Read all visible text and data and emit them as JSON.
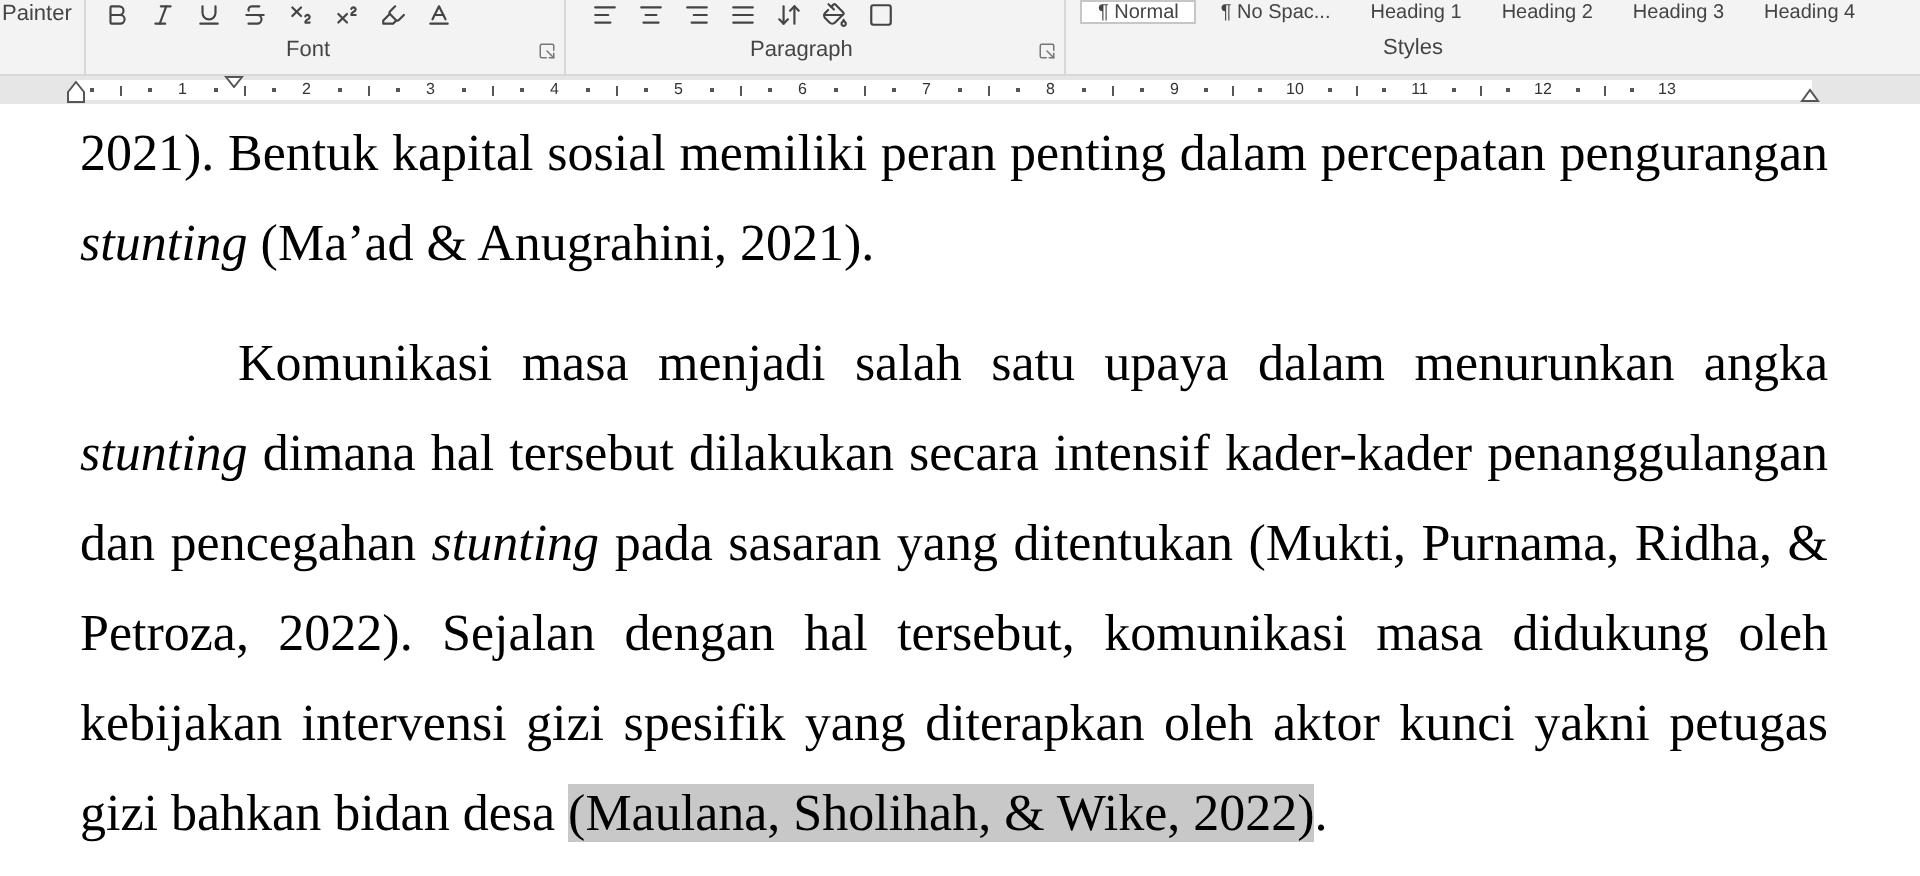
{
  "ribbon": {
    "clipboard_label": "Painter",
    "groups": [
      {
        "label": "Font"
      },
      {
        "label": "Paragraph"
      },
      {
        "label": "Styles"
      }
    ],
    "styles": [
      {
        "label": "¶ Normal",
        "selected": true
      },
      {
        "label": "¶ No Spac...",
        "selected": false
      },
      {
        "label": "Heading 1",
        "selected": false
      },
      {
        "label": "Heading 2",
        "selected": false
      },
      {
        "label": "Heading 3",
        "selected": false
      },
      {
        "label": "Heading 4",
        "selected": false
      }
    ]
  },
  "ruler": {
    "numbers": [
      "1",
      "2",
      "3",
      "4",
      "5",
      "6",
      "7",
      "8",
      "9",
      "10",
      "11",
      "12",
      "13"
    ]
  },
  "document": {
    "paragraphs": [
      {
        "first_line_indent": false,
        "segments": [
          {
            "text": "2021). Bentuk kapital sosial memiliki peran penting dalam percepatan pengurangan ",
            "kind": "plain"
          },
          {
            "text": "stunting",
            "kind": "italic"
          },
          {
            "text": " (Ma’ad & Anugrahini, 2021).",
            "kind": "plain"
          }
        ]
      },
      {
        "first_line_indent": true,
        "segments": [
          {
            "text": "Komunikasi masa menjadi salah satu upaya dalam menurunkan angka ",
            "kind": "plain"
          },
          {
            "text": "stunting",
            "kind": "italic"
          },
          {
            "text": " dimana hal tersebut dilakukan secara intensif kader-kader penanggulangan dan pencegahan ",
            "kind": "plain"
          },
          {
            "text": "stunting",
            "kind": "italic"
          },
          {
            "text": " pada sasaran yang ditentukan (Mukti, Purnama, Ridha, & Petroza, 2022). Sejalan dengan hal tersebut, komunikasi masa didukung oleh kebijakan intervensi gizi spesifik yang diterapkan oleh aktor kunci yakni petugas gizi bahkan bidan desa ",
            "kind": "plain"
          },
          {
            "text": "(Maulana, Sholihah, & Wike, 2022)",
            "kind": "selection"
          },
          {
            "text": ".",
            "kind": "plain"
          }
        ]
      }
    ]
  }
}
